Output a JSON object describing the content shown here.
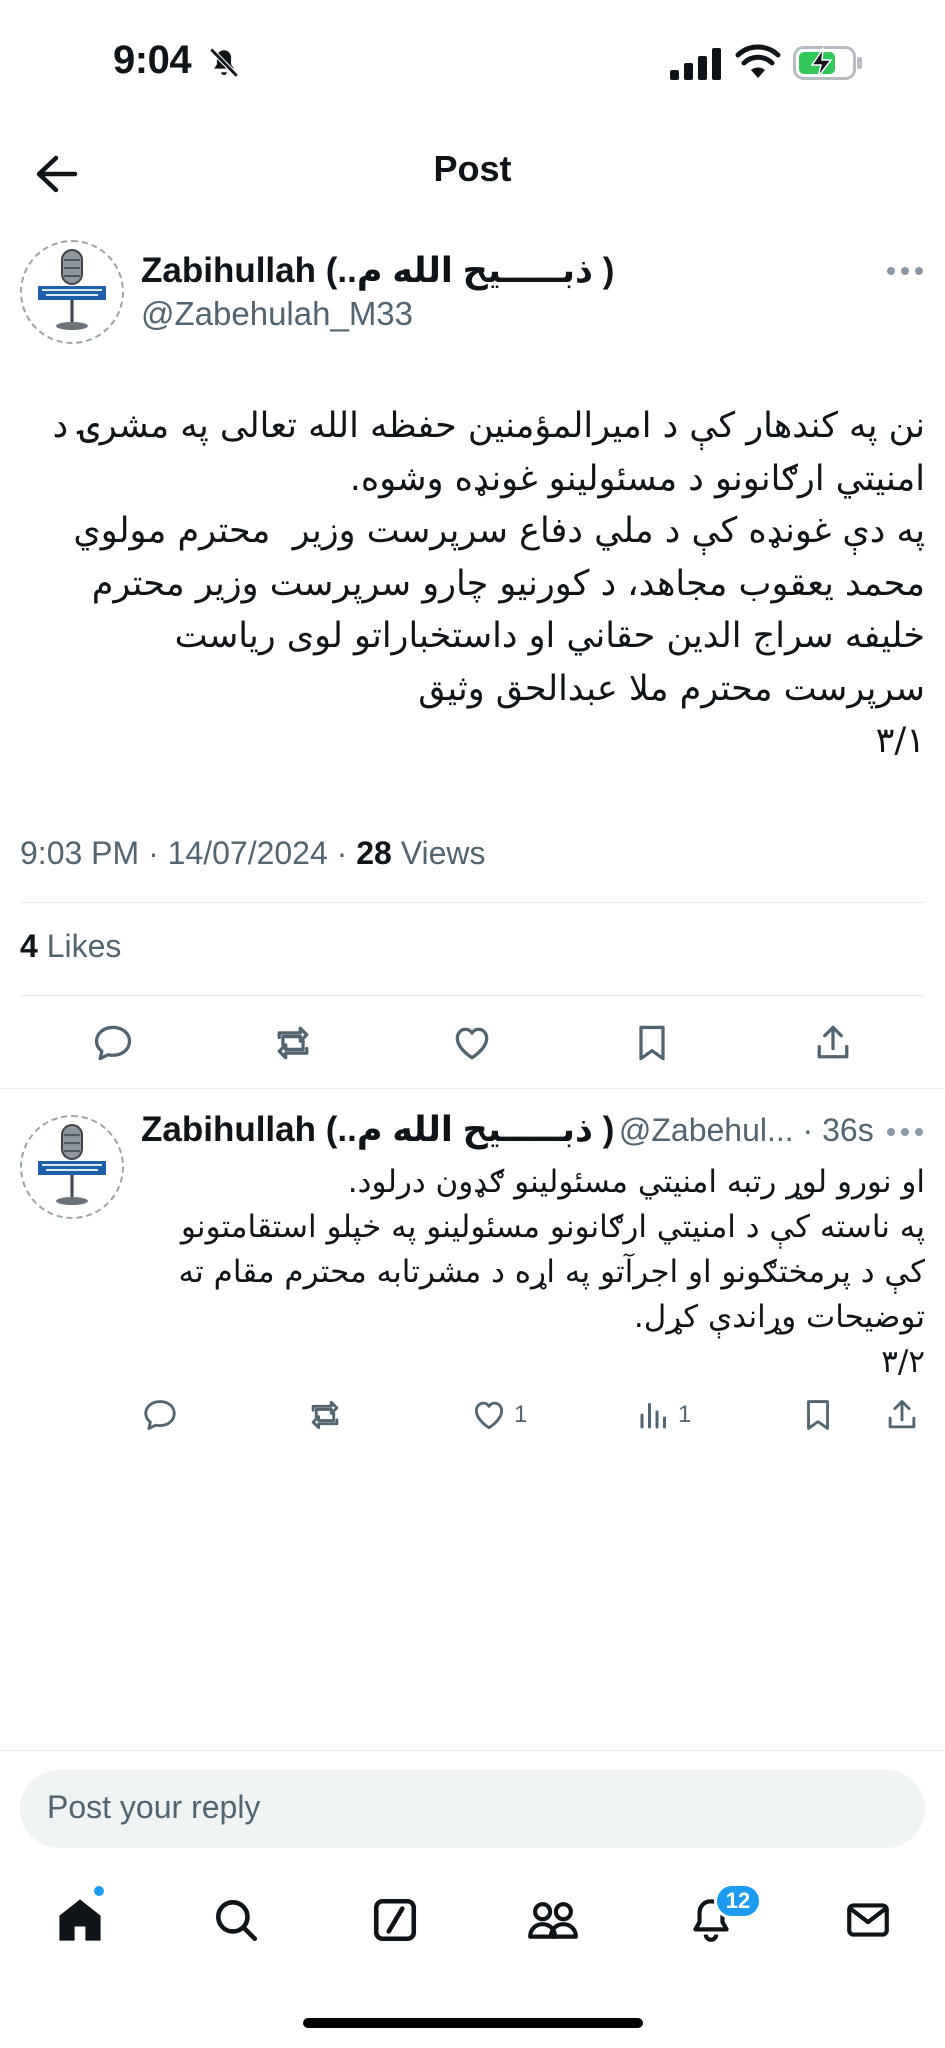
{
  "status_bar": {
    "time": "9:04"
  },
  "header": {
    "title": "Post"
  },
  "main_post": {
    "author_name": "Zabihullah (..ذبـــــيح الله م )",
    "handle": "@Zabehulah_M33",
    "text": "نن په کندهار کې د امیرالمؤمنین حفظه الله تعالی په مشرۍ د\nامنیتي ارګانونو د مسئولینو غونډه وشوه.\nپه دې غونډه کې د ملي دفاع سرپرست وزیر  محترم مولوي\nمحمد یعقوب مجاهد، د کورنیو چارو سرپرست وزیر محترم\nخلیفه سراج الدین حقاني او داستخباراتو لوی ریاست\nسرپرست محترم ملا عبدالحق وثیق\n۳/۱",
    "time": "9:03 PM",
    "date": "14/07/2024",
    "views_count": "28",
    "views_label": "Views",
    "likes_count": "4",
    "likes_label": "Likes"
  },
  "reply_post": {
    "author_name": "Zabihullah (..ذبـــــيح الله م )",
    "handle_time": "@Zabehul... · 36s",
    "text": "او نورو لوړ رتبه امنیتي مسئولینو ګډون درلود.\nپه ناسته کې د امنیتي ارګانونو مسئولینو په خپلو استقامتونو\nکې د پرمختګونو او اجرآتو په اړه د مشرتابه محترم مقام ته\nتوضیحات وړاندې کړل.\n۳/۲",
    "likes_count": "1",
    "views_count": "1"
  },
  "composer": {
    "placeholder": "Post your reply"
  },
  "tab_bar": {
    "notifications_badge": "12"
  },
  "colors": {
    "accent": "#1d9bf0",
    "text": "#0f1419",
    "secondary": "#536471",
    "divider": "#e6ecf0",
    "battery": "#34c759"
  }
}
